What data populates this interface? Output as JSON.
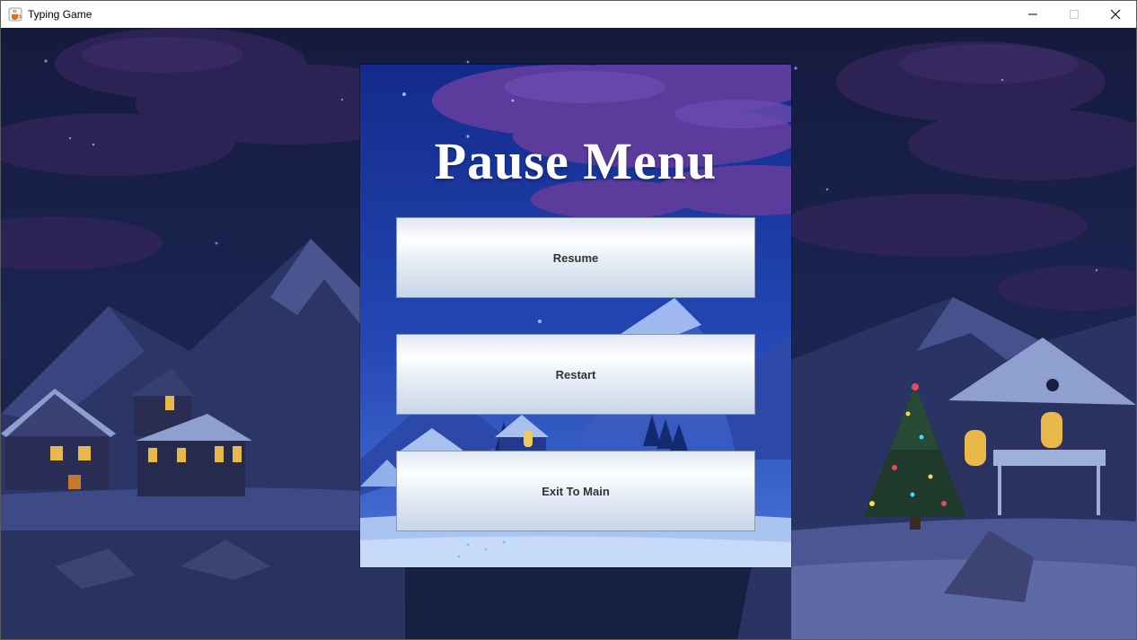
{
  "window": {
    "title": "Typing Game",
    "icon": "java-cup-icon",
    "controls": [
      "minimize-icon",
      "maximize-icon",
      "close-icon"
    ]
  },
  "pause_menu": {
    "title": "Pause Menu",
    "buttons": {
      "resume": "Resume",
      "restart": "Restart",
      "exit": "Exit To Main"
    }
  },
  "colors": {
    "sky_dark": "#0f1a3c",
    "panel_sky": "#1f3fa0",
    "cloud": "#5a3a9a",
    "snow": "#a9c4ee",
    "button_text": "#333333"
  }
}
